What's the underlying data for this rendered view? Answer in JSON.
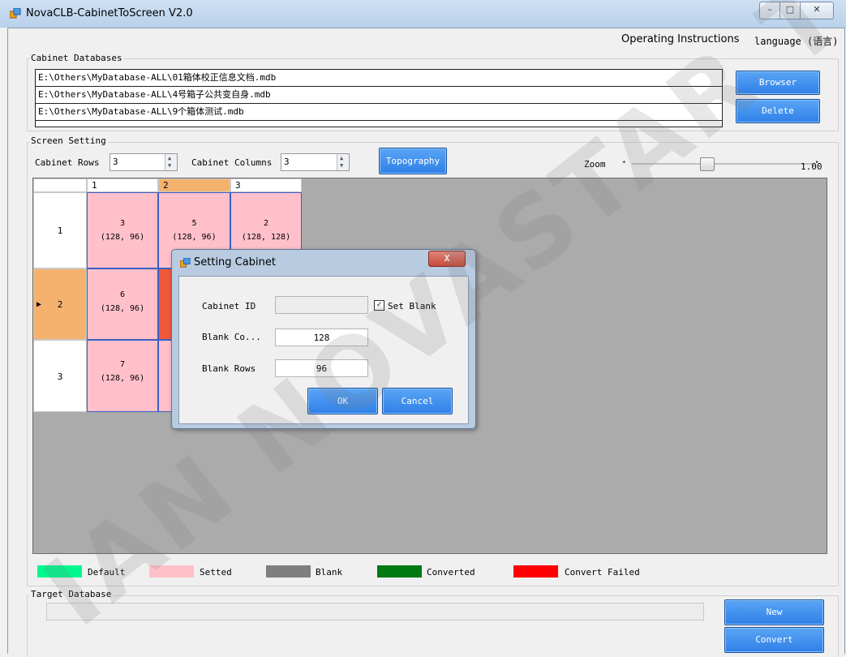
{
  "window": {
    "title": "NovaCLB-CabinetToScreen V2.0",
    "minimize_glyph": "–",
    "maximize_glyph": "□",
    "close_glyph": "✕"
  },
  "menu": {
    "instructions": "Operating Instructions",
    "language": "language (语言)"
  },
  "cabinet_databases": {
    "label": "Cabinet Databases",
    "items": [
      "E:\\Others\\MyDatabase-ALL\\01箱体校正信息文档.mdb",
      "E:\\Others\\MyDatabase-ALL\\4号箱子公共变自身.mdb",
      "E:\\Others\\MyDatabase-ALL\\9个箱体测试.mdb"
    ],
    "browser_label": "Browser",
    "delete_label": "Delete"
  },
  "screen_setting": {
    "label": "Screen Setting",
    "rows_label": "Cabinet Rows",
    "rows_value": "3",
    "cols_label": "Cabinet Columns",
    "cols_value": "3",
    "topography_label": "Topography",
    "zoom_label": "Zoom",
    "zoom_value": "1.00"
  },
  "grid": {
    "col_headers": [
      "1",
      "2",
      "3"
    ],
    "row_headers": [
      "1",
      "2",
      "3"
    ],
    "selected_row_marker": "▶",
    "cells": [
      [
        {
          "id": "3",
          "size": "(128, 96)"
        },
        {
          "id": "5",
          "size": "(128, 96)"
        },
        {
          "id": "2",
          "size": "(128, 128)"
        }
      ],
      [
        {
          "id": "6",
          "size": "(128, 96)"
        },
        {
          "id": "",
          "size": ""
        },
        {
          "id": "",
          "size": ""
        }
      ],
      [
        {
          "id": "7",
          "size": "(128, 96)"
        },
        {
          "id": "",
          "size": ""
        },
        {
          "id": "",
          "size": ""
        }
      ]
    ]
  },
  "legend": [
    {
      "label": "Default",
      "color": "#00f98f"
    },
    {
      "label": "Setted",
      "color": "#ffc0c8"
    },
    {
      "label": "Blank",
      "color": "#7f7f7f"
    },
    {
      "label": "Converted",
      "color": "#007a12"
    },
    {
      "label": "Convert Failed",
      "color": "#ff0000"
    }
  ],
  "target_database": {
    "label": "Target Database",
    "value": "",
    "new_label": "New",
    "convert_label": "Convert"
  },
  "dialog": {
    "title": "Setting Cabinet",
    "close_glyph": "X",
    "cabinet_id_label": "Cabinet ID",
    "cabinet_id_value": "",
    "set_blank_label": "Set Blank",
    "set_blank_checked": true,
    "check_glyph": "✓",
    "blank_cols_label": "Blank Co...",
    "blank_cols_value": "128",
    "blank_rows_label": "Blank Rows",
    "blank_rows_value": "96",
    "ok_label": "OK",
    "cancel_label": "Cancel"
  },
  "watermark": "IAN NOVASTAR T",
  "colors": {
    "button_blue": "#3a8cf0",
    "header_selected": "#f5b26e",
    "cell_pink": "#ffc0cb",
    "cell_red": "#f0583a",
    "grid_bg": "#ababab"
  }
}
